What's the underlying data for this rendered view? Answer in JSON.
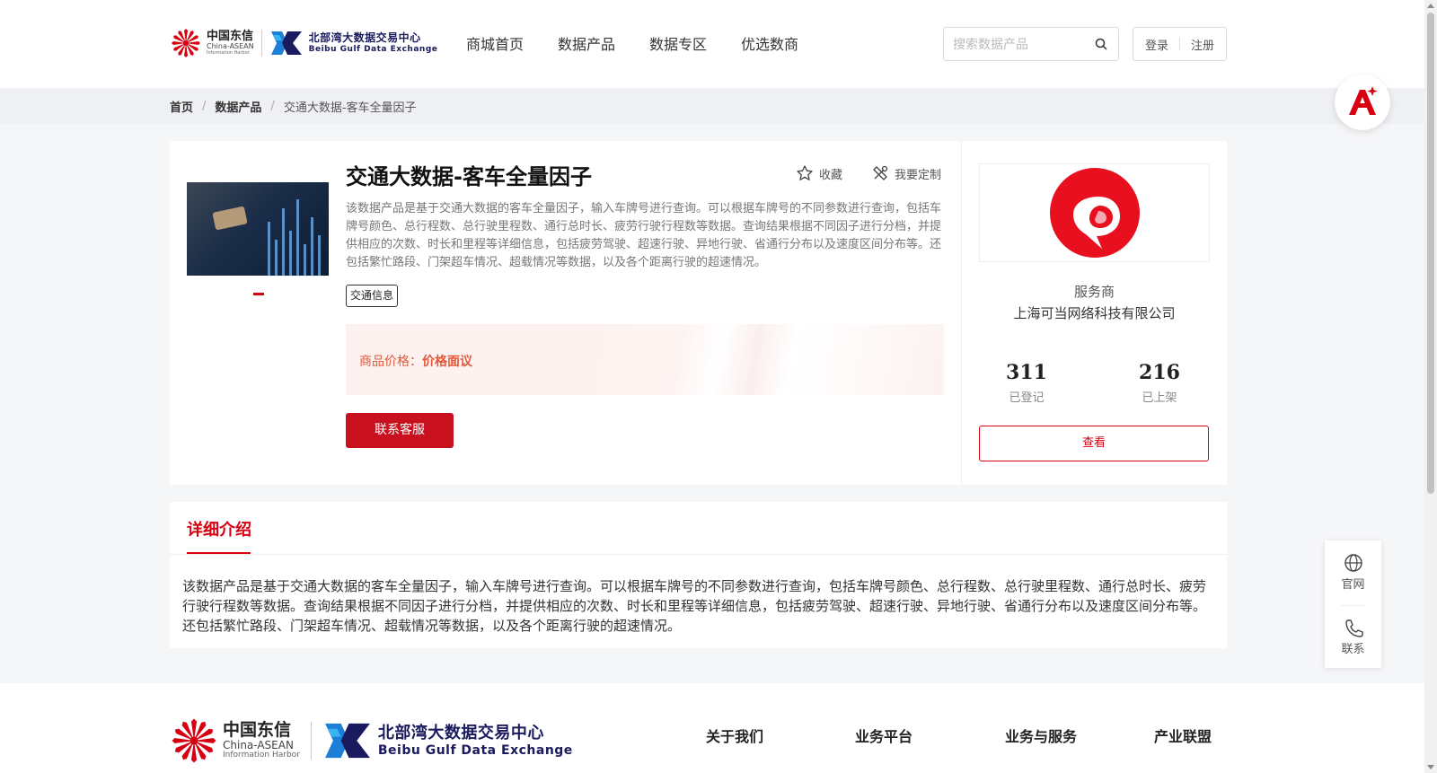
{
  "header": {
    "logo_ct_cn": "中国东信",
    "logo_ct_en": "China-ASEAN",
    "logo_ct_en2": "Information Harbor",
    "logo_bbgx_cn": "北部湾大数据交易中心",
    "logo_bbgx_en": "Beibu Gulf Data Exchange",
    "nav": [
      "商城首页",
      "数据产品",
      "数据专区",
      "优选数商"
    ],
    "search_placeholder": "搜索数据产品",
    "login": "登录",
    "register": "注册"
  },
  "breadcrumb": {
    "home": "首页",
    "category": "数据产品",
    "current": "交通大数据-客车全量因子"
  },
  "product": {
    "title": "交通大数据-客车全量因子",
    "favorite_label": "收藏",
    "custom_label": "我要定制",
    "description": "该数据产品是基于交通大数据的客车全量因子，输入车牌号进行查询。可以根据车牌号的不同参数进行查询，包括车牌号颜色、总行程数、总行驶里程数、通行总时长、疲劳行驶行程数等数据。查询结果根据不同因子进行分档，并提供相应的次数、时长和里程等详细信息，包括疲劳驾驶、超速行驶、异地行驶、省通行分布以及速度区间分布等。还包括繁忙路段、门架超车情况、超载情况等数据，以及各个距离行驶的超速情况。",
    "tag": "交通信息",
    "price_label": "商品价格：",
    "price_value": "价格面议",
    "contact_button": "联系客服"
  },
  "provider": {
    "label": "服务商",
    "name": "上海可当网络科技有限公司",
    "registered_count": "311",
    "registered_label": "已登记",
    "listed_count": "216",
    "listed_label": "已上架",
    "view_button": "查看"
  },
  "detail": {
    "tab": "详细介绍",
    "text": "该数据产品是基于交通大数据的客车全量因子，输入车牌号进行查询。可以根据车牌号的不同参数进行查询，包括车牌号颜色、总行程数、总行驶里程数、通行总时长、疲劳行驶行程数等数据。查询结果根据不同因子进行分档，并提供相应的次数、时长和里程等详细信息，包括疲劳驾驶、超速行驶、异地行驶、省通行分布以及速度区间分布等。还包括繁忙路段、门架超车情况、超载情况等数据，以及各个距离行驶的超速情况。"
  },
  "footer": {
    "links": [
      "关于我们",
      "业务平台",
      "业务与服务",
      "产业联盟"
    ]
  },
  "side": {
    "website": "官网",
    "contact": "联系"
  },
  "colors": {
    "brand_red": "#d60012",
    "price_orange": "#e05a3a"
  }
}
